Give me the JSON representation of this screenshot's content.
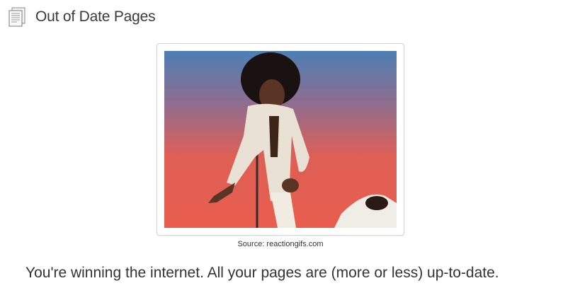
{
  "header": {
    "icon": "pages-icon",
    "title": "Out of Date Pages"
  },
  "figure": {
    "image": "reaction-gif",
    "caption": "Source: reactiongifs.com"
  },
  "message": "You're winning the internet. All your pages are (more or less) up-to-date."
}
